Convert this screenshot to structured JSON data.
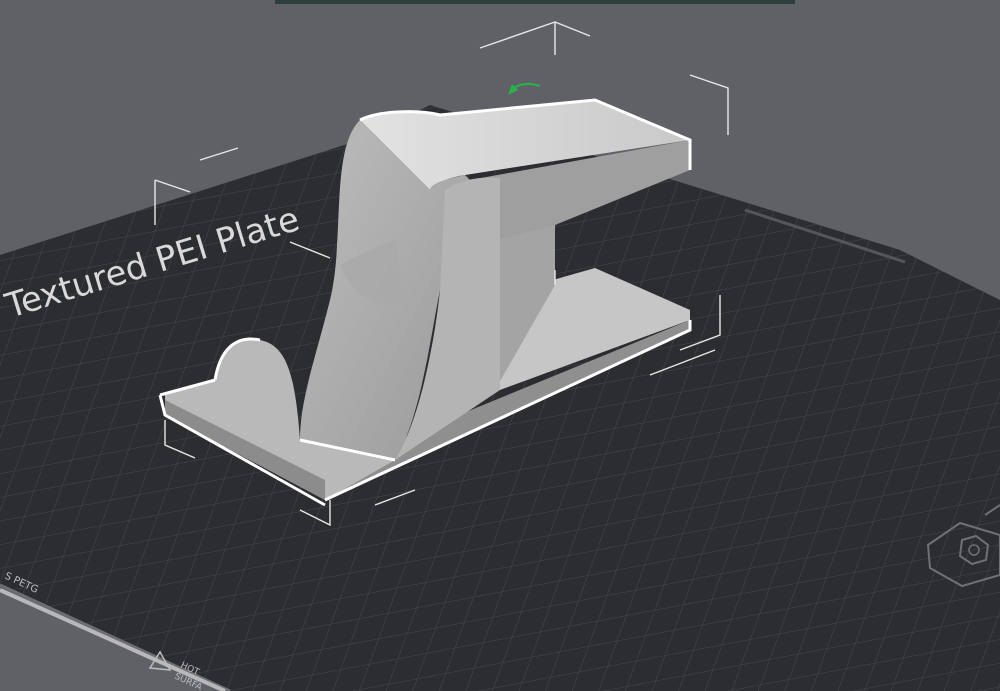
{
  "viewport": {
    "bed_label": "Textured PEI Plate",
    "filament_label": "S PETG",
    "hot_surface_label": [
      "HOT",
      "SURFA"
    ],
    "model_name": "",
    "gizmo_color": "#26b34a",
    "selection_outline_color": "#ffffff"
  },
  "icons": {
    "bed_logo": "hexagon-nut-icon",
    "hot_surface": "hot-surface-warning-icon",
    "rotate_gizmo": "rotate-gizmo-icon"
  }
}
